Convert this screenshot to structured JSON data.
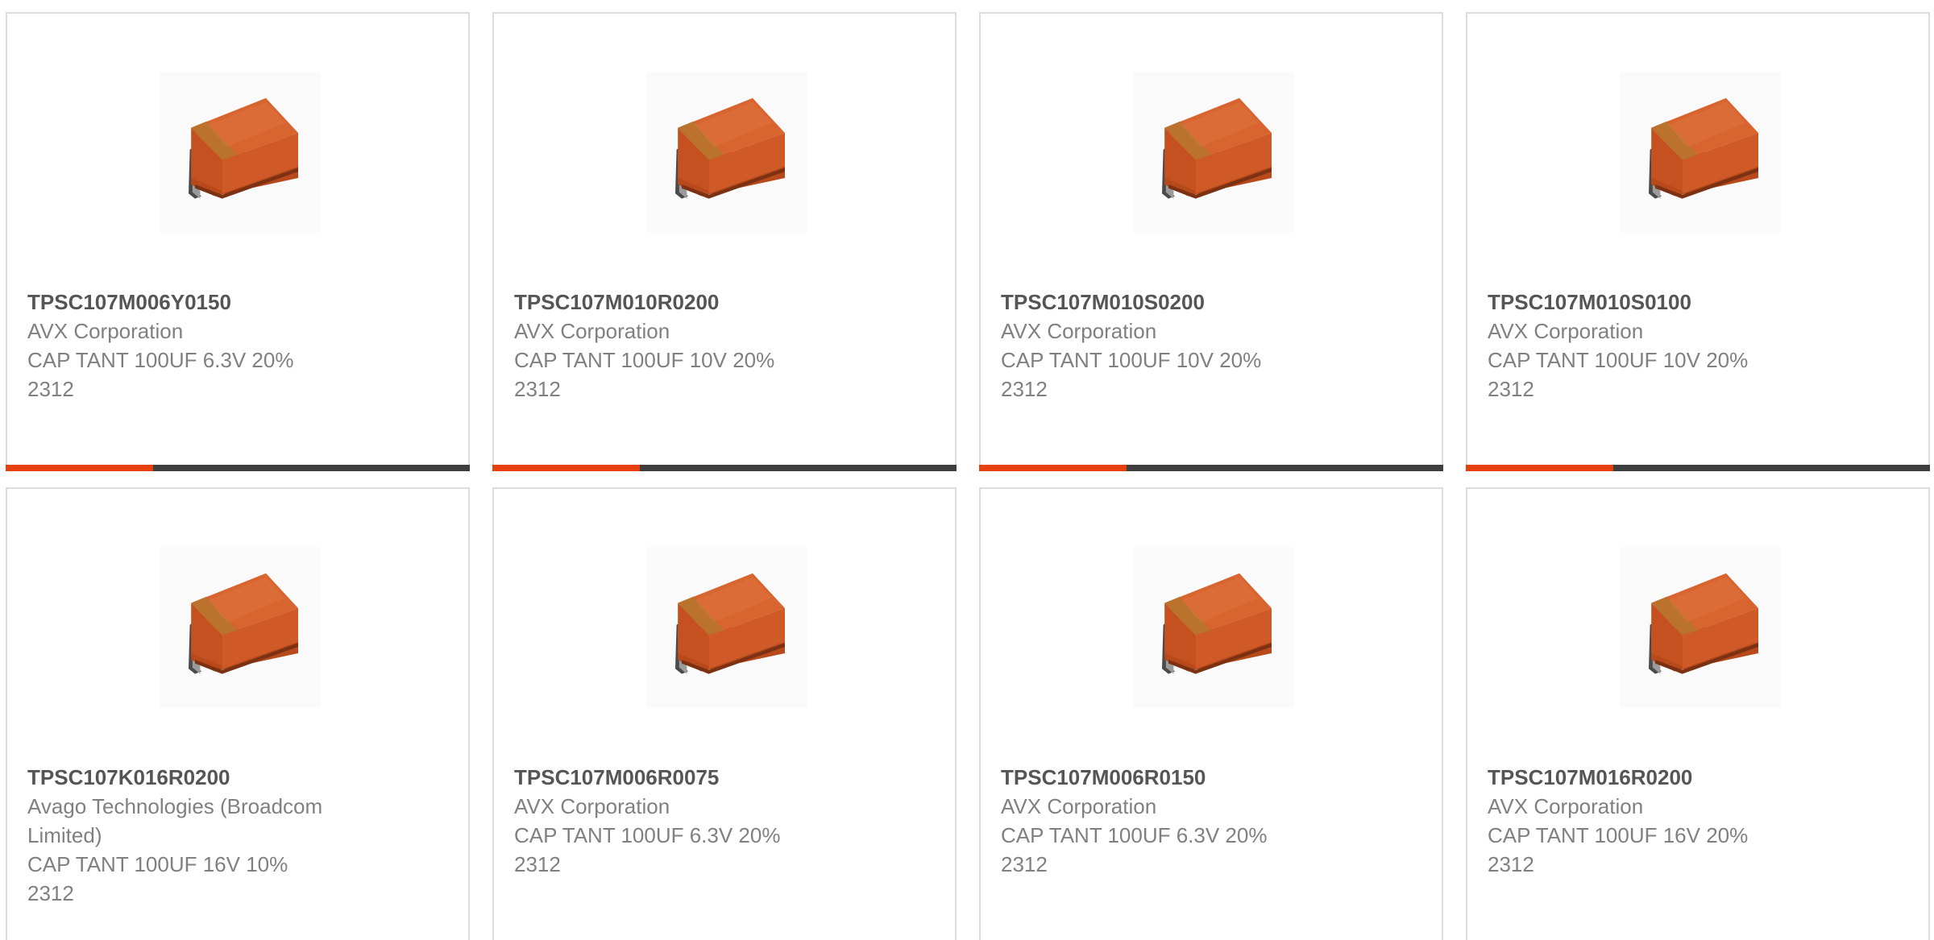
{
  "colors": {
    "accent": "#e8400c",
    "bar_dark": "#3e3e3e",
    "border": "#dcdcdc",
    "part_number": "#555555",
    "text": "#808080",
    "capacitor_body": "#cf5a2a"
  },
  "products": [
    {
      "part_number": "TPSC107M006Y0150",
      "manufacturer": "AVX Corporation",
      "description": "CAP TANT 100UF 6.3V 20%",
      "package": "2312",
      "image_icon": "tantalum-capacitor-icon"
    },
    {
      "part_number": "TPSC107M010R0200",
      "manufacturer": "AVX Corporation",
      "description": "CAP TANT 100UF 10V 20%",
      "package": "2312",
      "image_icon": "tantalum-capacitor-icon"
    },
    {
      "part_number": "TPSC107M010S0200",
      "manufacturer": "AVX Corporation",
      "description": "CAP TANT 100UF 10V 20%",
      "package": "2312",
      "image_icon": "tantalum-capacitor-icon"
    },
    {
      "part_number": "TPSC107M010S0100",
      "manufacturer": "AVX Corporation",
      "description": "CAP TANT 100UF 10V 20%",
      "package": "2312",
      "image_icon": "tantalum-capacitor-icon"
    },
    {
      "part_number": "TPSC107K016R0200",
      "manufacturer": "Avago Technologies (Broadcom Limited)",
      "description": "CAP TANT 100UF 16V 10%",
      "package": "2312",
      "image_icon": "tantalum-capacitor-icon"
    },
    {
      "part_number": "TPSC107M006R0075",
      "manufacturer": "AVX Corporation",
      "description": "CAP TANT 100UF 6.3V 20%",
      "package": "2312",
      "image_icon": "tantalum-capacitor-icon"
    },
    {
      "part_number": "TPSC107M006R0150",
      "manufacturer": "AVX Corporation",
      "description": "CAP TANT 100UF 6.3V 20%",
      "package": "2312",
      "image_icon": "tantalum-capacitor-icon"
    },
    {
      "part_number": "TPSC107M016R0200",
      "manufacturer": "AVX Corporation",
      "description": "CAP TANT 100UF 16V 20%",
      "package": "2312",
      "image_icon": "tantalum-capacitor-icon"
    }
  ]
}
